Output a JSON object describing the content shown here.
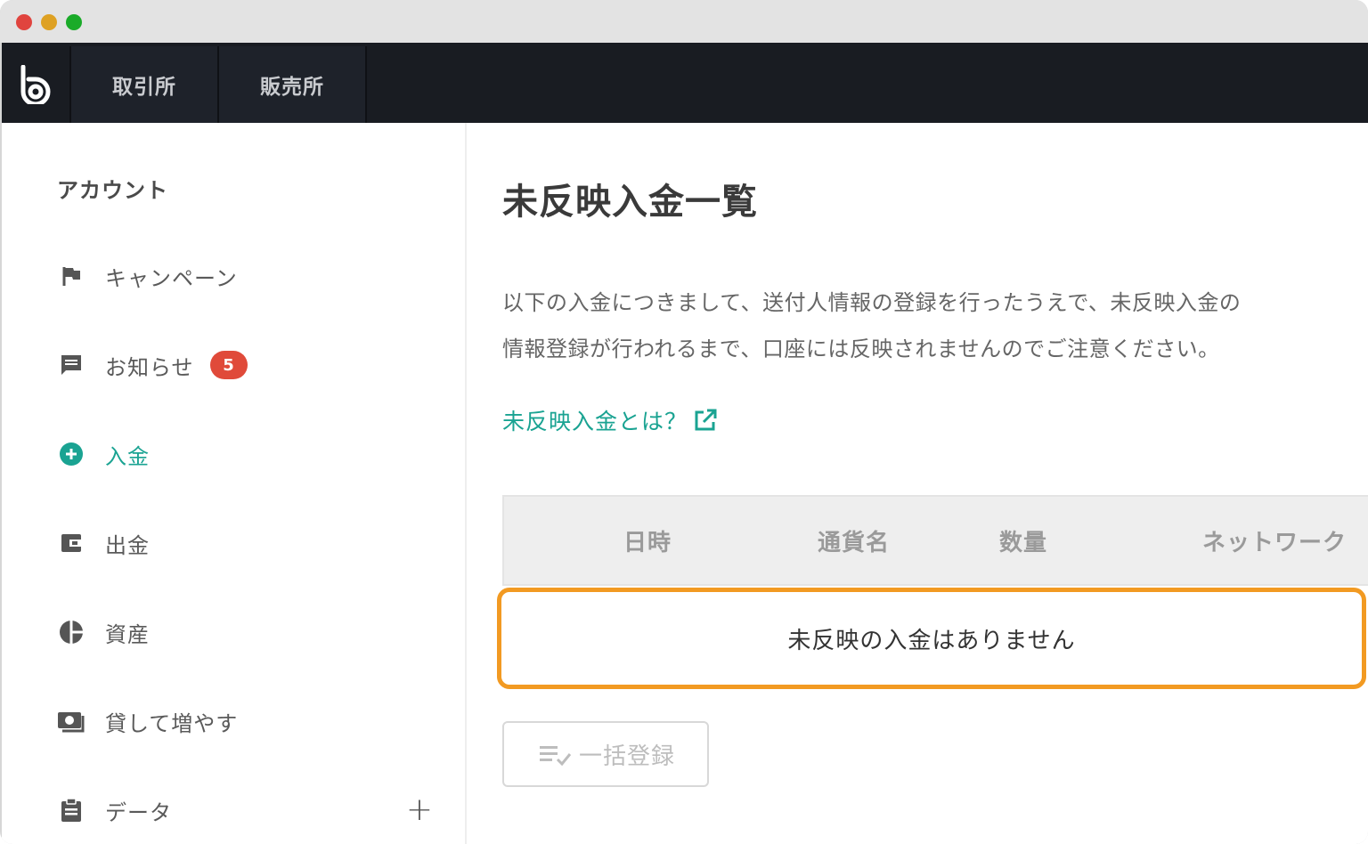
{
  "nav": {
    "tabs": [
      {
        "label": "取引所"
      },
      {
        "label": "販売所"
      }
    ]
  },
  "sidebar": {
    "heading": "アカウント",
    "items": [
      {
        "label": "キャンペーン",
        "icon": "flag-icon"
      },
      {
        "label": "お知らせ",
        "icon": "message-icon",
        "badge": "5"
      },
      {
        "label": "入金",
        "icon": "plus-circle-icon",
        "active": true
      },
      {
        "label": "出金",
        "icon": "wallet-icon"
      },
      {
        "label": "資産",
        "icon": "pie-chart-icon"
      },
      {
        "label": "貸して増やす",
        "icon": "cash-icon"
      },
      {
        "label": "データ",
        "icon": "clipboard-icon",
        "expand": "+"
      }
    ]
  },
  "main": {
    "title": "未反映入金一覧",
    "description_line1": "以下の入金につきまして、送付人情報の登録を行ったうえで、未反映入金の",
    "description_line2": "情報登録が行われるまで、口座には反映されませんのでご注意ください。",
    "help_link": "未反映入金とは？",
    "table": {
      "columns": [
        "日時",
        "通貨名",
        "数量",
        "ネットワーク"
      ],
      "empty_message": "未反映の入金はありません"
    },
    "bulk_button": "一括登録"
  },
  "colors": {
    "accent": "#1aa392",
    "highlight": "#f29a22",
    "badge": "#e04a3a",
    "nav_bg": "#191c22"
  }
}
